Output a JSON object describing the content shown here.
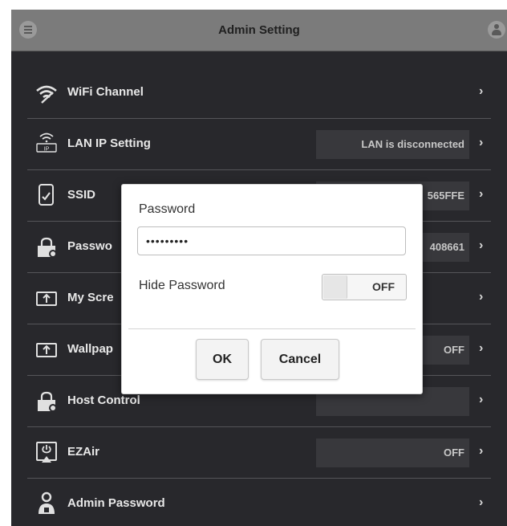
{
  "header": {
    "title": "Admin Setting",
    "menu_icon": "menu-icon",
    "user_icon": "user-icon"
  },
  "rows": [
    {
      "label": "WiFi Channel",
      "icon": "wifi-icon",
      "value": ""
    },
    {
      "label": "LAN IP Setting",
      "icon": "lan-ip-icon",
      "value": "LAN is disconnected"
    },
    {
      "label": "SSID",
      "icon": "device-icon",
      "value": "565FFE"
    },
    {
      "label": "Passwo",
      "icon": "lock-icon",
      "value": "408661"
    },
    {
      "label": "My Scre",
      "icon": "upload-screen-icon",
      "value": ""
    },
    {
      "label": "Wallpap",
      "icon": "upload-screen-icon",
      "value": "OFF"
    },
    {
      "label": "Host Control",
      "icon": "lock-icon",
      "value": ""
    },
    {
      "label": "EZAir",
      "icon": "power-icon",
      "value": "OFF"
    },
    {
      "label": "Admin Password",
      "icon": "admin-lock-icon",
      "value": ""
    }
  ],
  "dialog": {
    "password_label": "Password",
    "password_value": "•••••••••",
    "hide_password_label": "Hide Password",
    "toggle_state": "OFF",
    "ok_label": "OK",
    "cancel_label": "Cancel"
  },
  "chevron": "›"
}
